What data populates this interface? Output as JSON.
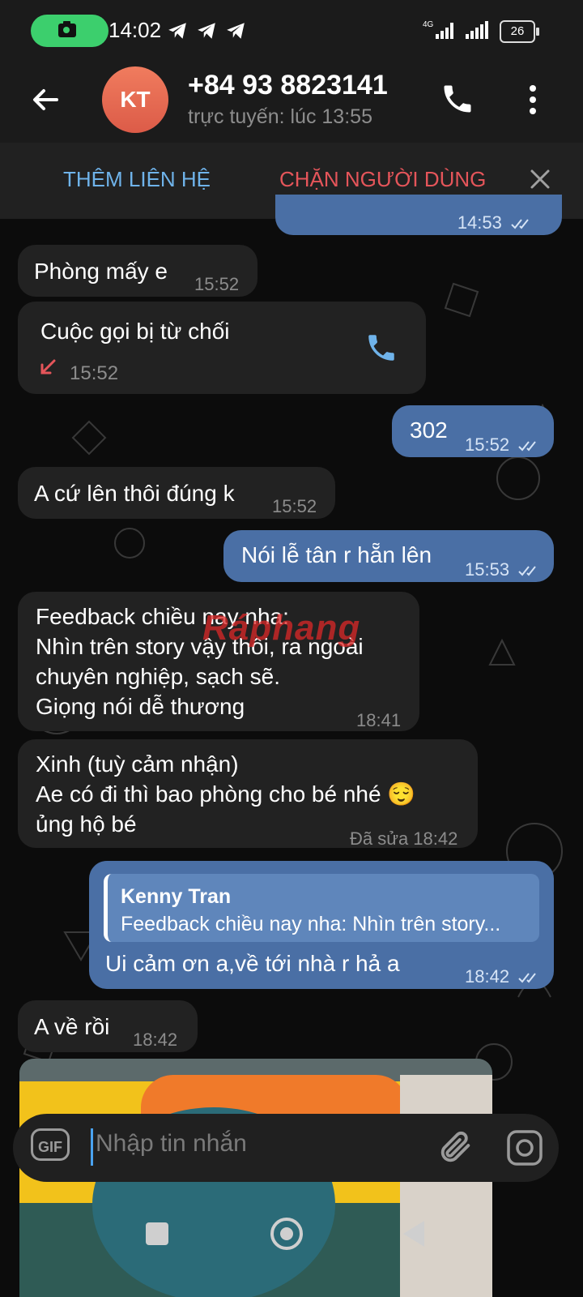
{
  "status_bar": {
    "time": "14:02",
    "network": "4G",
    "battery": "26"
  },
  "header": {
    "avatar_initials": "KT",
    "contact_name": "+84 93 8823141",
    "contact_status": "trực tuyến: lúc 13:55"
  },
  "action_bar": {
    "add_contact": "THÊM LIÊN HỆ",
    "block_user": "CHẶN NGƯỜI DÙNG"
  },
  "messages": [
    {
      "dir": "out",
      "text": "",
      "time": "14:53"
    },
    {
      "dir": "in",
      "text": "Phòng mấy e",
      "time": "15:52"
    },
    {
      "dir": "in",
      "type": "call",
      "text": "Cuộc gọi bị từ chối",
      "time": "15:52"
    },
    {
      "dir": "out",
      "text": "302",
      "time": "15:52"
    },
    {
      "dir": "in",
      "text": "A cứ lên thôi đúng k",
      "time": "15:52"
    },
    {
      "dir": "out",
      "text": "Nói lễ tân r hẵn lên",
      "time": "15:53"
    },
    {
      "dir": "in",
      "lines": [
        "Feedback chiều nay nha:",
        "Nhìn trên story vậy thôi, ra ngoài",
        "chuyên nghiệp, sạch sẽ.",
        "Giọng nói dễ thương"
      ],
      "time": "18:41"
    },
    {
      "dir": "in",
      "lines": [
        "Xinh (tuỳ cảm nhận)",
        "Ae có đi thì bao phòng cho bé nhé 😌",
        "ủng hộ bé"
      ],
      "time": "Đã sửa 18:42"
    },
    {
      "dir": "out",
      "reply_name": "Kenny Tran",
      "reply_text": "Feedback chiều nay nha: Nhìn trên story...",
      "text": "Ui cảm ơn a,về tới nhà r hả a",
      "time": "18:42"
    },
    {
      "dir": "in",
      "text": "A về rồi",
      "time": "18:42"
    }
  ],
  "watermark": "Ráphang",
  "composer": {
    "placeholder": "Nhập tin nhắn",
    "gif_label": "GIF"
  }
}
